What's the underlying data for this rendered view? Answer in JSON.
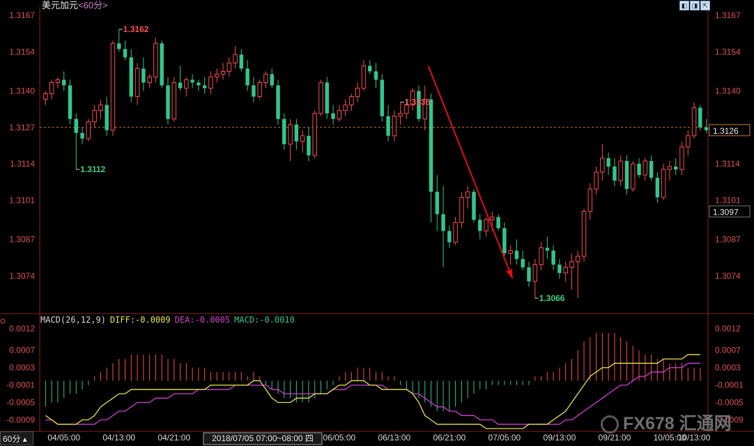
{
  "chart_title": "美元加元",
  "timeframe": "60分",
  "timeframe_tab": "60分",
  "toolbar_icons": [
    "pan-icon",
    "zoom-icon",
    "expand-icon"
  ],
  "macd_header": {
    "label": "MACD(26,12,9)",
    "diff": "DIFF:-0.0009",
    "dea": "DEA:-0.0005",
    "macd": "MACD:-0.0010"
  },
  "current_price_label": "1.3126",
  "cursor_price_label": "1.3097",
  "crosshair_time_label": "2018/07/05 07:00~08:00 四",
  "watermark": "FX678 汇通网",
  "colors": {
    "up": "#ff4d4d",
    "down": "#33c58e",
    "diff_line": "#e6e64a",
    "dea_line": "#d040d0",
    "axis_label": "#e05050",
    "annotation_high": "#ff5050",
    "annotation_low": "#40d080",
    "dashed_line": "#c87a28",
    "trend_arrow": "#e01010"
  },
  "chart_data": [
    {
      "type": "candlestick",
      "y_ticks": [
        "1.3167",
        "1.3154",
        "1.3140",
        "1.3127",
        "1.3114",
        "1.3101",
        "1.3087",
        "1.3074"
      ],
      "ylim": [
        1.3061,
        1.3169
      ],
      "x_ticks": [
        "04/05:00",
        "04/13:00",
        "04/21:00",
        "05/0",
        "06/05:00",
        "06/13:00",
        "06/21:00",
        "07/05:00",
        "09/13:00",
        "09/21:00",
        "10/05:00",
        "10/13:00"
      ],
      "annotations": [
        {
          "label": "1.3162",
          "kind": "high"
        },
        {
          "label": "1.3112",
          "kind": "low"
        },
        {
          "label": "1.3066",
          "kind": "low"
        },
        {
          "label": "1.3136",
          "kind": "high"
        }
      ],
      "reference_line": 1.3127,
      "candles": [
        [
          1.3137,
          1.314,
          1.3135,
          1.3139
        ],
        [
          1.3139,
          1.3144,
          1.3137,
          1.3143
        ],
        [
          1.3143,
          1.3145,
          1.3141,
          1.3144
        ],
        [
          1.3144,
          1.3147,
          1.314,
          1.3142
        ],
        [
          1.3142,
          1.3144,
          1.3128,
          1.313
        ],
        [
          1.313,
          1.3132,
          1.3112,
          1.3125
        ],
        [
          1.3125,
          1.3127,
          1.3121,
          1.3123
        ],
        [
          1.3123,
          1.313,
          1.3122,
          1.3129
        ],
        [
          1.3129,
          1.3135,
          1.3127,
          1.3133
        ],
        [
          1.3133,
          1.3137,
          1.313,
          1.3135
        ],
        [
          1.3135,
          1.3138,
          1.3124,
          1.3126
        ],
        [
          1.3126,
          1.3158,
          1.3124,
          1.3157
        ],
        [
          1.3157,
          1.3162,
          1.3154,
          1.3155
        ],
        [
          1.3155,
          1.3158,
          1.3151,
          1.3152
        ],
        [
          1.3152,
          1.3155,
          1.3136,
          1.3138
        ],
        [
          1.3138,
          1.315,
          1.3135,
          1.3148
        ],
        [
          1.3148,
          1.3152,
          1.314,
          1.3143
        ],
        [
          1.3143,
          1.3146,
          1.3141,
          1.3145
        ],
        [
          1.3145,
          1.3159,
          1.3143,
          1.3157
        ],
        [
          1.3157,
          1.3158,
          1.3141,
          1.3142
        ],
        [
          1.3142,
          1.3145,
          1.3128,
          1.313
        ],
        [
          1.313,
          1.3145,
          1.3129,
          1.3143
        ],
        [
          1.3143,
          1.3149,
          1.314,
          1.3141
        ],
        [
          1.3141,
          1.3145,
          1.3138,
          1.3144
        ],
        [
          1.3144,
          1.3146,
          1.3141,
          1.3143
        ],
        [
          1.3143,
          1.3144,
          1.314,
          1.3142
        ],
        [
          1.3142,
          1.3145,
          1.3139,
          1.3141
        ],
        [
          1.3141,
          1.3147,
          1.3139,
          1.3145
        ],
        [
          1.3145,
          1.3148,
          1.3143,
          1.3146
        ],
        [
          1.3146,
          1.315,
          1.3144,
          1.3147
        ],
        [
          1.3147,
          1.3152,
          1.3145,
          1.315
        ],
        [
          1.315,
          1.3156,
          1.3148,
          1.3153
        ],
        [
          1.3153,
          1.3155,
          1.3147,
          1.3148
        ],
        [
          1.3148,
          1.3151,
          1.314,
          1.3142
        ],
        [
          1.3142,
          1.3145,
          1.3136,
          1.3138
        ],
        [
          1.3138,
          1.3144,
          1.3137,
          1.3143
        ],
        [
          1.3143,
          1.3147,
          1.3141,
          1.3146
        ],
        [
          1.3146,
          1.3148,
          1.3141,
          1.3142
        ],
        [
          1.3142,
          1.3144,
          1.3128,
          1.313
        ],
        [
          1.313,
          1.3132,
          1.3119,
          1.3121
        ],
        [
          1.3121,
          1.313,
          1.3115,
          1.3128
        ],
        [
          1.3128,
          1.313,
          1.3119,
          1.3122
        ],
        [
          1.3122,
          1.3126,
          1.3118,
          1.3124
        ],
        [
          1.3124,
          1.3127,
          1.3115,
          1.3117
        ],
        [
          1.3117,
          1.3133,
          1.3116,
          1.3132
        ],
        [
          1.3132,
          1.3144,
          1.3131,
          1.3143
        ],
        [
          1.3143,
          1.3145,
          1.313,
          1.3132
        ],
        [
          1.3132,
          1.3135,
          1.3128,
          1.313
        ],
        [
          1.313,
          1.3135,
          1.3129,
          1.3133
        ],
        [
          1.3133,
          1.3137,
          1.3131,
          1.3135
        ],
        [
          1.3135,
          1.3139,
          1.3133,
          1.3138
        ],
        [
          1.3138,
          1.3143,
          1.3136,
          1.3141
        ],
        [
          1.3141,
          1.3151,
          1.314,
          1.3149
        ],
        [
          1.3149,
          1.3151,
          1.3146,
          1.3147
        ],
        [
          1.3147,
          1.315,
          1.3141,
          1.3144
        ],
        [
          1.3144,
          1.3146,
          1.3129,
          1.3131
        ],
        [
          1.3131,
          1.3135,
          1.3122,
          1.3124
        ],
        [
          1.3124,
          1.3133,
          1.3122,
          1.3131
        ],
        [
          1.3131,
          1.3136,
          1.3128,
          1.3132
        ],
        [
          1.3132,
          1.3137,
          1.313,
          1.3135
        ],
        [
          1.3135,
          1.3141,
          1.3133,
          1.314
        ],
        [
          1.314,
          1.3142,
          1.3129,
          1.313
        ],
        [
          1.313,
          1.3142,
          1.3126,
          1.3137
        ],
        [
          1.3137,
          1.3139,
          1.3093,
          1.3104
        ],
        [
          1.3104,
          1.311,
          1.309,
          1.3096
        ],
        [
          1.3096,
          1.3106,
          1.3077,
          1.309
        ],
        [
          1.309,
          1.3092,
          1.3084,
          1.3086
        ],
        [
          1.3086,
          1.3095,
          1.3085,
          1.3093
        ],
        [
          1.3093,
          1.3104,
          1.3091,
          1.3102
        ],
        [
          1.3102,
          1.3106,
          1.3098,
          1.3104
        ],
        [
          1.3104,
          1.3105,
          1.3093,
          1.3094
        ],
        [
          1.3094,
          1.3096,
          1.3087,
          1.309
        ],
        [
          1.309,
          1.3095,
          1.3088,
          1.3094
        ],
        [
          1.3094,
          1.3097,
          1.309,
          1.3095
        ],
        [
          1.3095,
          1.3096,
          1.309,
          1.3091
        ],
        [
          1.3091,
          1.3093,
          1.3081,
          1.3082
        ],
        [
          1.3082,
          1.3085,
          1.3078,
          1.3083
        ],
        [
          1.3083,
          1.3087,
          1.3078,
          1.308
        ],
        [
          1.308,
          1.3083,
          1.3076,
          1.3077
        ],
        [
          1.3077,
          1.3079,
          1.307,
          1.3072
        ],
        [
          1.3072,
          1.308,
          1.3066,
          1.3078
        ],
        [
          1.3078,
          1.3086,
          1.3076,
          1.3084
        ],
        [
          1.3084,
          1.3088,
          1.308,
          1.3083
        ],
        [
          1.3083,
          1.3085,
          1.3076,
          1.3078
        ],
        [
          1.3078,
          1.308,
          1.3073,
          1.3075
        ],
        [
          1.3075,
          1.3079,
          1.3072,
          1.3077
        ],
        [
          1.3077,
          1.3082,
          1.3069,
          1.3079
        ],
        [
          1.3079,
          1.3083,
          1.3066,
          1.3081
        ],
        [
          1.3081,
          1.3098,
          1.3079,
          1.3097
        ],
        [
          1.3097,
          1.3107,
          1.3094,
          1.3105
        ],
        [
          1.3105,
          1.3113,
          1.3103,
          1.3111
        ],
        [
          1.3111,
          1.3121,
          1.3108,
          1.3116
        ],
        [
          1.3116,
          1.3118,
          1.311,
          1.3113
        ],
        [
          1.3113,
          1.3116,
          1.3106,
          1.3108
        ],
        [
          1.3108,
          1.3117,
          1.3106,
          1.3115
        ],
        [
          1.3115,
          1.3117,
          1.3103,
          1.3105
        ],
        [
          1.3105,
          1.3115,
          1.3104,
          1.3114
        ],
        [
          1.3114,
          1.3116,
          1.3109,
          1.311
        ],
        [
          1.311,
          1.3116,
          1.3108,
          1.3115
        ],
        [
          1.3115,
          1.3117,
          1.3108,
          1.3109
        ],
        [
          1.3109,
          1.3111,
          1.31,
          1.3102
        ],
        [
          1.3102,
          1.3114,
          1.3101,
          1.3112
        ],
        [
          1.3112,
          1.3115,
          1.3108,
          1.3113
        ],
        [
          1.3113,
          1.3116,
          1.311,
          1.3112
        ],
        [
          1.3112,
          1.3122,
          1.311,
          1.312
        ],
        [
          1.312,
          1.3126,
          1.3117,
          1.3124
        ],
        [
          1.3124,
          1.3136,
          1.3123,
          1.3134
        ],
        [
          1.3134,
          1.3135,
          1.3126,
          1.3127
        ],
        [
          1.3127,
          1.313,
          1.3125,
          1.3126
        ]
      ]
    },
    {
      "type": "macd",
      "y_ticks": [
        "0.0012",
        "0.0007",
        "0.0003",
        "-0.0001",
        "-0.0005",
        "-0.0009"
      ],
      "ylim": [
        -0.0011,
        0.00135
      ],
      "histogram": [
        -0.0006,
        -0.0005,
        -0.0005,
        -0.0004,
        -0.0003,
        -0.0003,
        -0.0002,
        -0.0001,
        0.0001,
        0.0002,
        0.0003,
        0.0004,
        0.0005,
        0.0005,
        0.0006,
        0.0006,
        0.0006,
        0.0006,
        0.0006,
        0.0006,
        0.0005,
        0.0005,
        0.0004,
        0.0004,
        0.0003,
        0.0003,
        0.0003,
        0.0002,
        0.0002,
        0.0002,
        0.0002,
        0.0002,
        0.0002,
        0.0001,
        0.0002,
        0.0001,
        -0.0001,
        -0.0002,
        -0.0003,
        -0.0004,
        -0.0004,
        -0.0005,
        -0.0005,
        -0.0005,
        -0.0004,
        -0.0003,
        -0.0002,
        -0.0001,
        0.0001,
        0.0002,
        0.0002,
        0.0003,
        0.0003,
        0.0003,
        0.0002,
        0.0002,
        0.0001,
        0.0001,
        -0.0001,
        -0.0002,
        -0.0003,
        -0.0004,
        -0.0005,
        -0.0006,
        -0.0007,
        -0.0007,
        -0.0007,
        -0.0006,
        -0.0005,
        -0.0004,
        -0.0003,
        -0.0002,
        -0.0002,
        -0.0001,
        -0.0001,
        -0.0001,
        -0.0001,
        -0.0001,
        -0.0001,
        -0.0001,
        0.0001,
        0.0001,
        0.0002,
        0.0002,
        0.0003,
        0.0004,
        0.0005,
        0.0007,
        0.0009,
        0.001,
        0.0011,
        0.0011,
        0.0011,
        0.0011,
        0.001,
        0.0009,
        0.0008,
        0.0007,
        0.0006,
        0.0006,
        0.0005,
        0.0005,
        0.0004,
        0.0004,
        0.0004,
        0.0003,
        0.0003,
        0.0003
      ],
      "diff": [
        -0.0008,
        -0.0009,
        -0.001,
        -0.001,
        -0.001,
        -0.001,
        -0.0009,
        -0.0009,
        -0.0008,
        -0.0006,
        -0.0005,
        -0.0004,
        -0.0003,
        -0.0003,
        -0.0002,
        -0.0002,
        -0.0002,
        -0.0002,
        -0.0002,
        -0.0002,
        -0.0002,
        -0.0002,
        -0.0002,
        -0.0002,
        -0.0002,
        -0.0002,
        -0.0002,
        -0.0001,
        -0.0001,
        -0.0001,
        -0.0001,
        -0.0001,
        -0.0001,
        -0.0001,
        0.0,
        0.0,
        -0.0002,
        -0.0004,
        -0.0005,
        -0.0005,
        -0.0005,
        -0.0004,
        -0.0004,
        -0.0004,
        -0.0003,
        -0.0003,
        -0.0003,
        -0.0002,
        -0.0001,
        -0.0001,
        0.0,
        0.0,
        0.0,
        -0.0001,
        -0.0001,
        -0.0002,
        -0.0002,
        -0.0002,
        -0.0002,
        -0.0002,
        -0.0003,
        -0.0005,
        -0.0008,
        -0.0009,
        -0.001,
        -0.001,
        -0.001,
        -0.001,
        -0.001,
        -0.001,
        -0.001,
        -0.001,
        -0.0011,
        -0.0011,
        -0.0011,
        -0.0011,
        -0.0011,
        -0.0011,
        -0.0011,
        -0.001,
        -0.001,
        -0.001,
        -0.001,
        -0.0009,
        -0.0008,
        -0.0007,
        -0.0005,
        -0.0003,
        -0.0001,
        0.0001,
        0.0002,
        0.0003,
        0.0003,
        0.0004,
        0.0004,
        0.0004,
        0.0004,
        0.0004,
        0.0004,
        0.0004,
        0.0004,
        0.0005,
        0.0005,
        0.0005,
        0.0005,
        0.0006,
        0.0006,
        0.0006
      ],
      "dea": [
        -0.0009,
        -0.0009,
        -0.001,
        -0.001,
        -0.001,
        -0.001,
        -0.001,
        -0.001,
        -0.001,
        -0.0009,
        -0.0009,
        -0.0008,
        -0.0007,
        -0.0007,
        -0.0006,
        -0.0005,
        -0.0005,
        -0.0005,
        -0.0004,
        -0.0004,
        -0.0004,
        -0.0003,
        -0.0003,
        -0.0003,
        -0.0003,
        -0.0002,
        -0.0002,
        -0.0002,
        -0.0002,
        -0.0002,
        -0.0002,
        -0.0001,
        -0.0001,
        -0.0001,
        -0.0001,
        -0.0001,
        -0.0001,
        -0.0002,
        -0.0002,
        -0.0003,
        -0.0003,
        -0.0003,
        -0.0003,
        -0.0003,
        -0.0003,
        -0.0003,
        -0.0003,
        -0.0002,
        -0.0002,
        -0.0002,
        -0.0001,
        -0.0001,
        -0.0001,
        -0.0001,
        -0.0001,
        -0.0001,
        -0.0002,
        -0.0002,
        -0.0002,
        -0.0002,
        -0.0003,
        -0.0003,
        -0.0004,
        -0.0005,
        -0.0006,
        -0.0006,
        -0.0007,
        -0.0007,
        -0.0008,
        -0.0008,
        -0.0008,
        -0.0009,
        -0.0009,
        -0.0009,
        -0.001,
        -0.001,
        -0.001,
        -0.001,
        -0.001,
        -0.001,
        -0.001,
        -0.001,
        -0.001,
        -0.001,
        -0.001,
        -0.0009,
        -0.0009,
        -0.0008,
        -0.0007,
        -0.0006,
        -0.0005,
        -0.0004,
        -0.0003,
        -0.0002,
        -0.0001,
        -0.0001,
        0.0,
        0.0001,
        0.0001,
        0.0002,
        0.0002,
        0.0002,
        0.0003,
        0.0003,
        0.0003,
        0.0004,
        0.0004,
        0.0004
      ]
    }
  ]
}
